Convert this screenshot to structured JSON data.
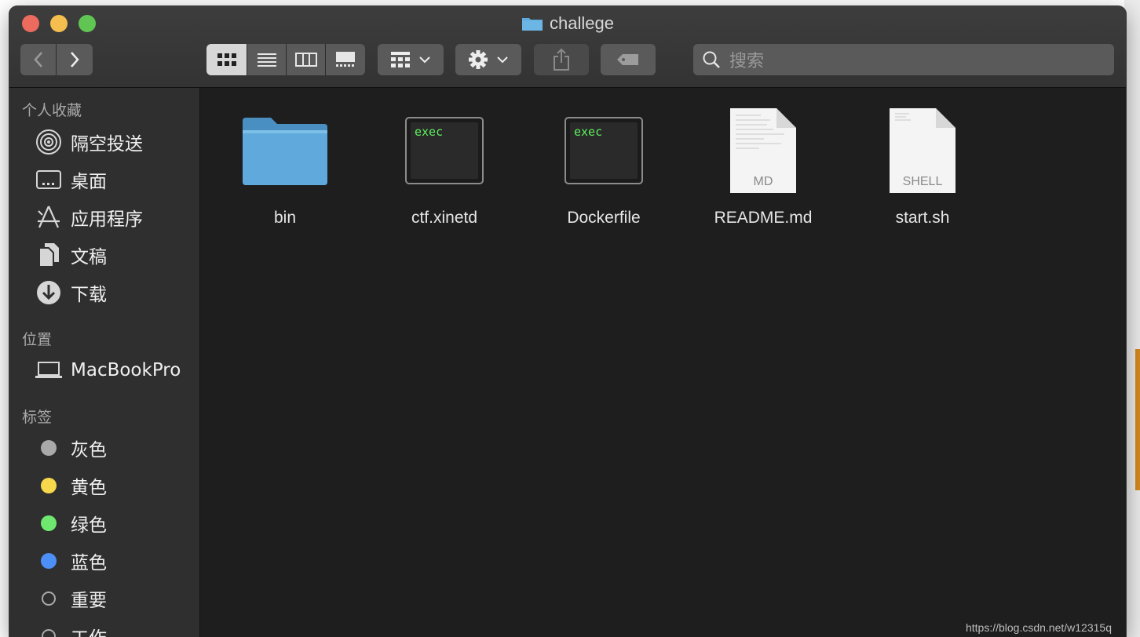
{
  "window": {
    "title": "challege"
  },
  "toolbar": {
    "back_icon": "chevron-left-icon",
    "forward_icon": "chevron-right-icon",
    "view_modes": [
      "icon-view",
      "list-view",
      "column-view",
      "gallery-view"
    ],
    "active_view": "icon-view",
    "search_placeholder": "搜索"
  },
  "sidebar": {
    "sections": [
      {
        "header": "个人收藏",
        "items": [
          {
            "label": "隔空投送",
            "icon": "airdrop-icon"
          },
          {
            "label": "桌面",
            "icon": "desktop-icon"
          },
          {
            "label": "应用程序",
            "icon": "applications-icon"
          },
          {
            "label": "文稿",
            "icon": "documents-icon"
          },
          {
            "label": "下载",
            "icon": "downloads-icon"
          }
        ]
      },
      {
        "header": "位置",
        "items": [
          {
            "label": "MacBookPro",
            "icon": "laptop-icon"
          }
        ]
      },
      {
        "header": "标签",
        "items": [
          {
            "label": "灰色",
            "color": "#a9a9a9"
          },
          {
            "label": "黄色",
            "color": "#f7d84c"
          },
          {
            "label": "绿色",
            "color": "#6ee86e"
          },
          {
            "label": "蓝色",
            "color": "#4c8ff7"
          },
          {
            "label": "重要",
            "color": "outline"
          },
          {
            "label": "工作",
            "color": "outline"
          }
        ]
      }
    ]
  },
  "files": [
    {
      "name": "bin",
      "kind": "folder"
    },
    {
      "name": "ctf.xinetd",
      "kind": "exec",
      "badge": "exec"
    },
    {
      "name": "Dockerfile",
      "kind": "exec",
      "badge": "exec"
    },
    {
      "name": "README.md",
      "kind": "document",
      "badge": "MD"
    },
    {
      "name": "start.sh",
      "kind": "document",
      "badge": "SHELL"
    }
  ],
  "watermark": "https://blog.csdn.net/w12315q",
  "colors": {
    "folder_blue": "#5fa9dc",
    "exec_text": "#5ef05e",
    "window_bg": "#1e1e1e",
    "sidebar_bg": "#2f2f2f"
  }
}
